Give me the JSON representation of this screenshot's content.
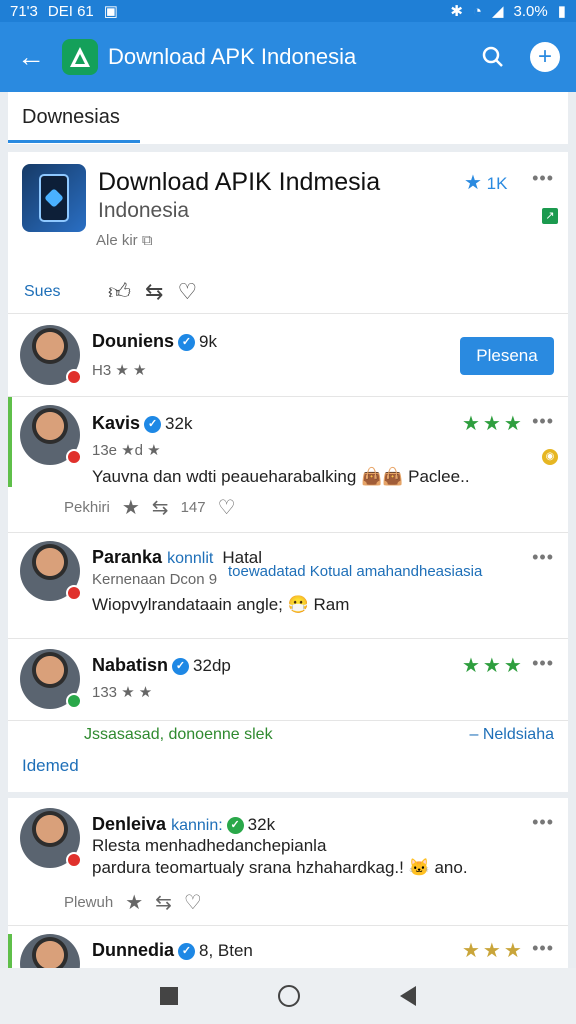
{
  "status_bar": {
    "left_text": "71'3",
    "carrier": "DEI 61",
    "battery": "3.0%"
  },
  "app_bar": {
    "title": "Download APK Indonesia"
  },
  "tabs": {
    "active": "Downesias"
  },
  "app": {
    "title": "Download APIK Indmesia",
    "subtitle": "Indonesia",
    "meta": "Ale kir",
    "rating_count": "1K",
    "actions_label": "Sues"
  },
  "comments": [
    {
      "name": "Douniens",
      "count": "9k",
      "sub": "H3 ★ ★",
      "button": "Plesena"
    },
    {
      "name": "Kavis",
      "count": "32k",
      "sub": "13e ★d ★",
      "text": "Yauvna dan wdti peaueharabalking 👜👜 Paclee..",
      "footer_label": "Pekhiri",
      "footer_count": "147"
    },
    {
      "name": "Paranka",
      "tag": "konnlit",
      "extra": "Hatal",
      "sub": "Kernenaan Dcon 9",
      "line2": "toewadatad Kotual amahandheasiasia",
      "text": "Wiopvylrandataain angle; 😷 Ram"
    },
    {
      "name": "Nabatisn",
      "count": "32dp",
      "sub": "133 ★ ★"
    }
  ],
  "bottom_line": {
    "left": "Jssasasad, donoenne slek",
    "right": "– Neldsiaha",
    "section": "Idemed"
  },
  "card2": [
    {
      "name": "Denleiva",
      "tag": "kannin:",
      "count": "32k",
      "line1": "Rlesta menhadhedanchepianla",
      "line2": "pardura teomartualy srana hzhahardkag.! 🐱 ano.",
      "footer_label": "Plewuh"
    },
    {
      "name": "Dunnedia",
      "count": "8, Bten"
    }
  ]
}
